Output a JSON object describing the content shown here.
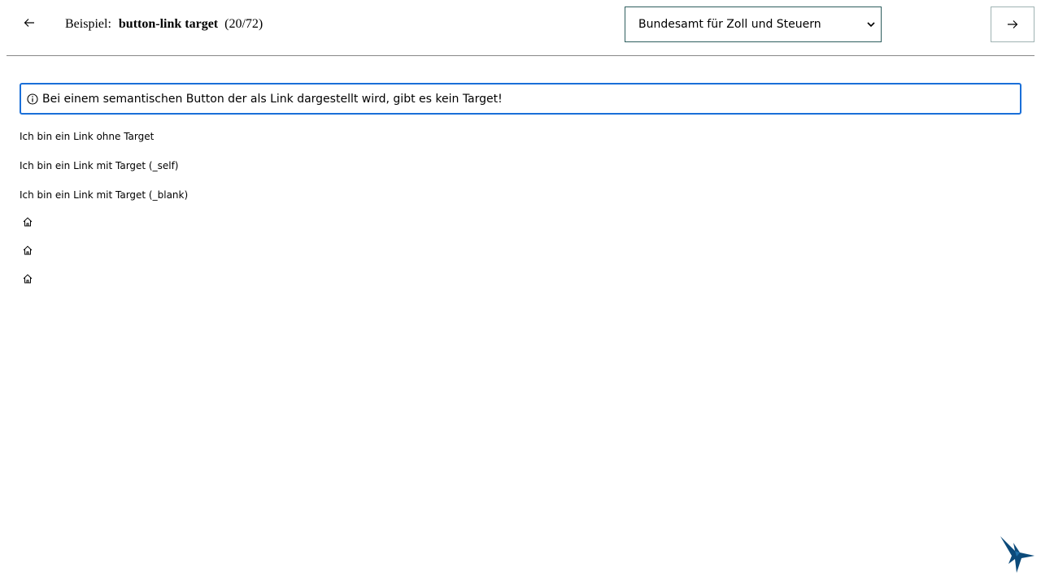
{
  "header": {
    "example_label": "Beispiel:",
    "example_name": "button-link target",
    "example_count": "(20/72)",
    "select_value": "Bundesamt für Zoll und Steuern"
  },
  "alert": {
    "text": "Bei einem semantischen Button der als Link dargestellt wird, gibt es kein Target!"
  },
  "links": [
    "Ich bin ein Link ohne Target",
    "Ich bin ein Link mit Target (_self)",
    "Ich bin ein Link mit Target (_blank)"
  ],
  "icons": {
    "back": "arrow-left-icon",
    "next": "arrow-right-icon",
    "select": "chevron-down-icon",
    "info": "info-icon",
    "home": "home-icon",
    "logo": "hummingbird-logo"
  },
  "colors": {
    "alert_border": "#1a6fd8",
    "select_border": "#2e5e5e",
    "logo": "#0b4a7a"
  }
}
